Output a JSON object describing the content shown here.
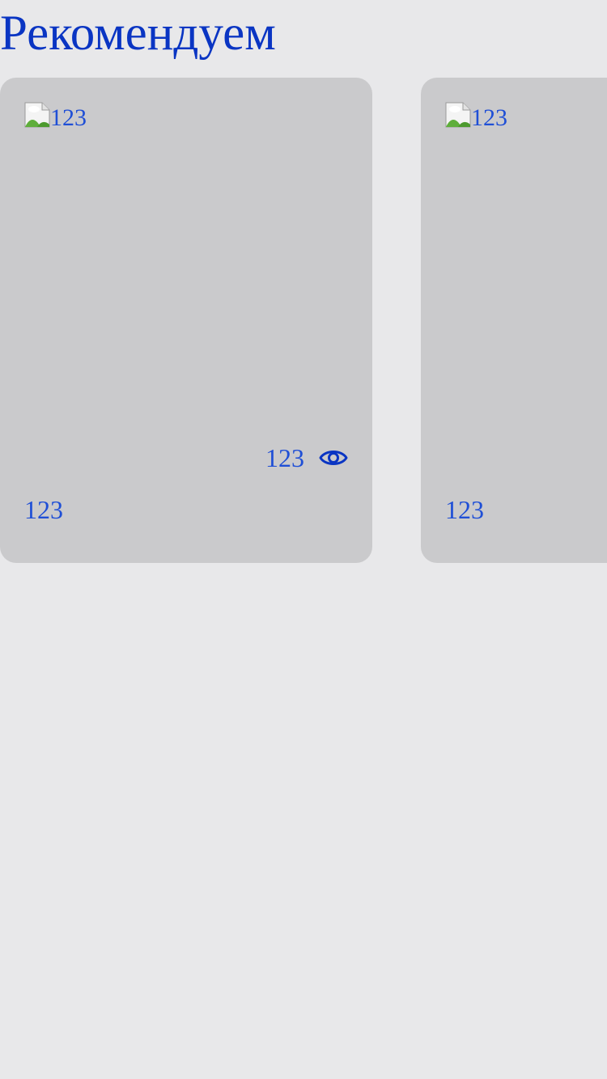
{
  "header": {
    "title": "Рекомендуем"
  },
  "colors": {
    "background": "#e8e8ea",
    "card_background": "#cacacc",
    "title": "#0a35c3",
    "text": "#1f4fd6"
  },
  "cards": [
    {
      "image_alt": "123",
      "image_icon": "broken-image-icon",
      "views": "123",
      "views_icon": "eye-icon",
      "caption": "123"
    },
    {
      "image_alt": "123",
      "image_icon": "broken-image-icon",
      "caption": "123"
    }
  ]
}
